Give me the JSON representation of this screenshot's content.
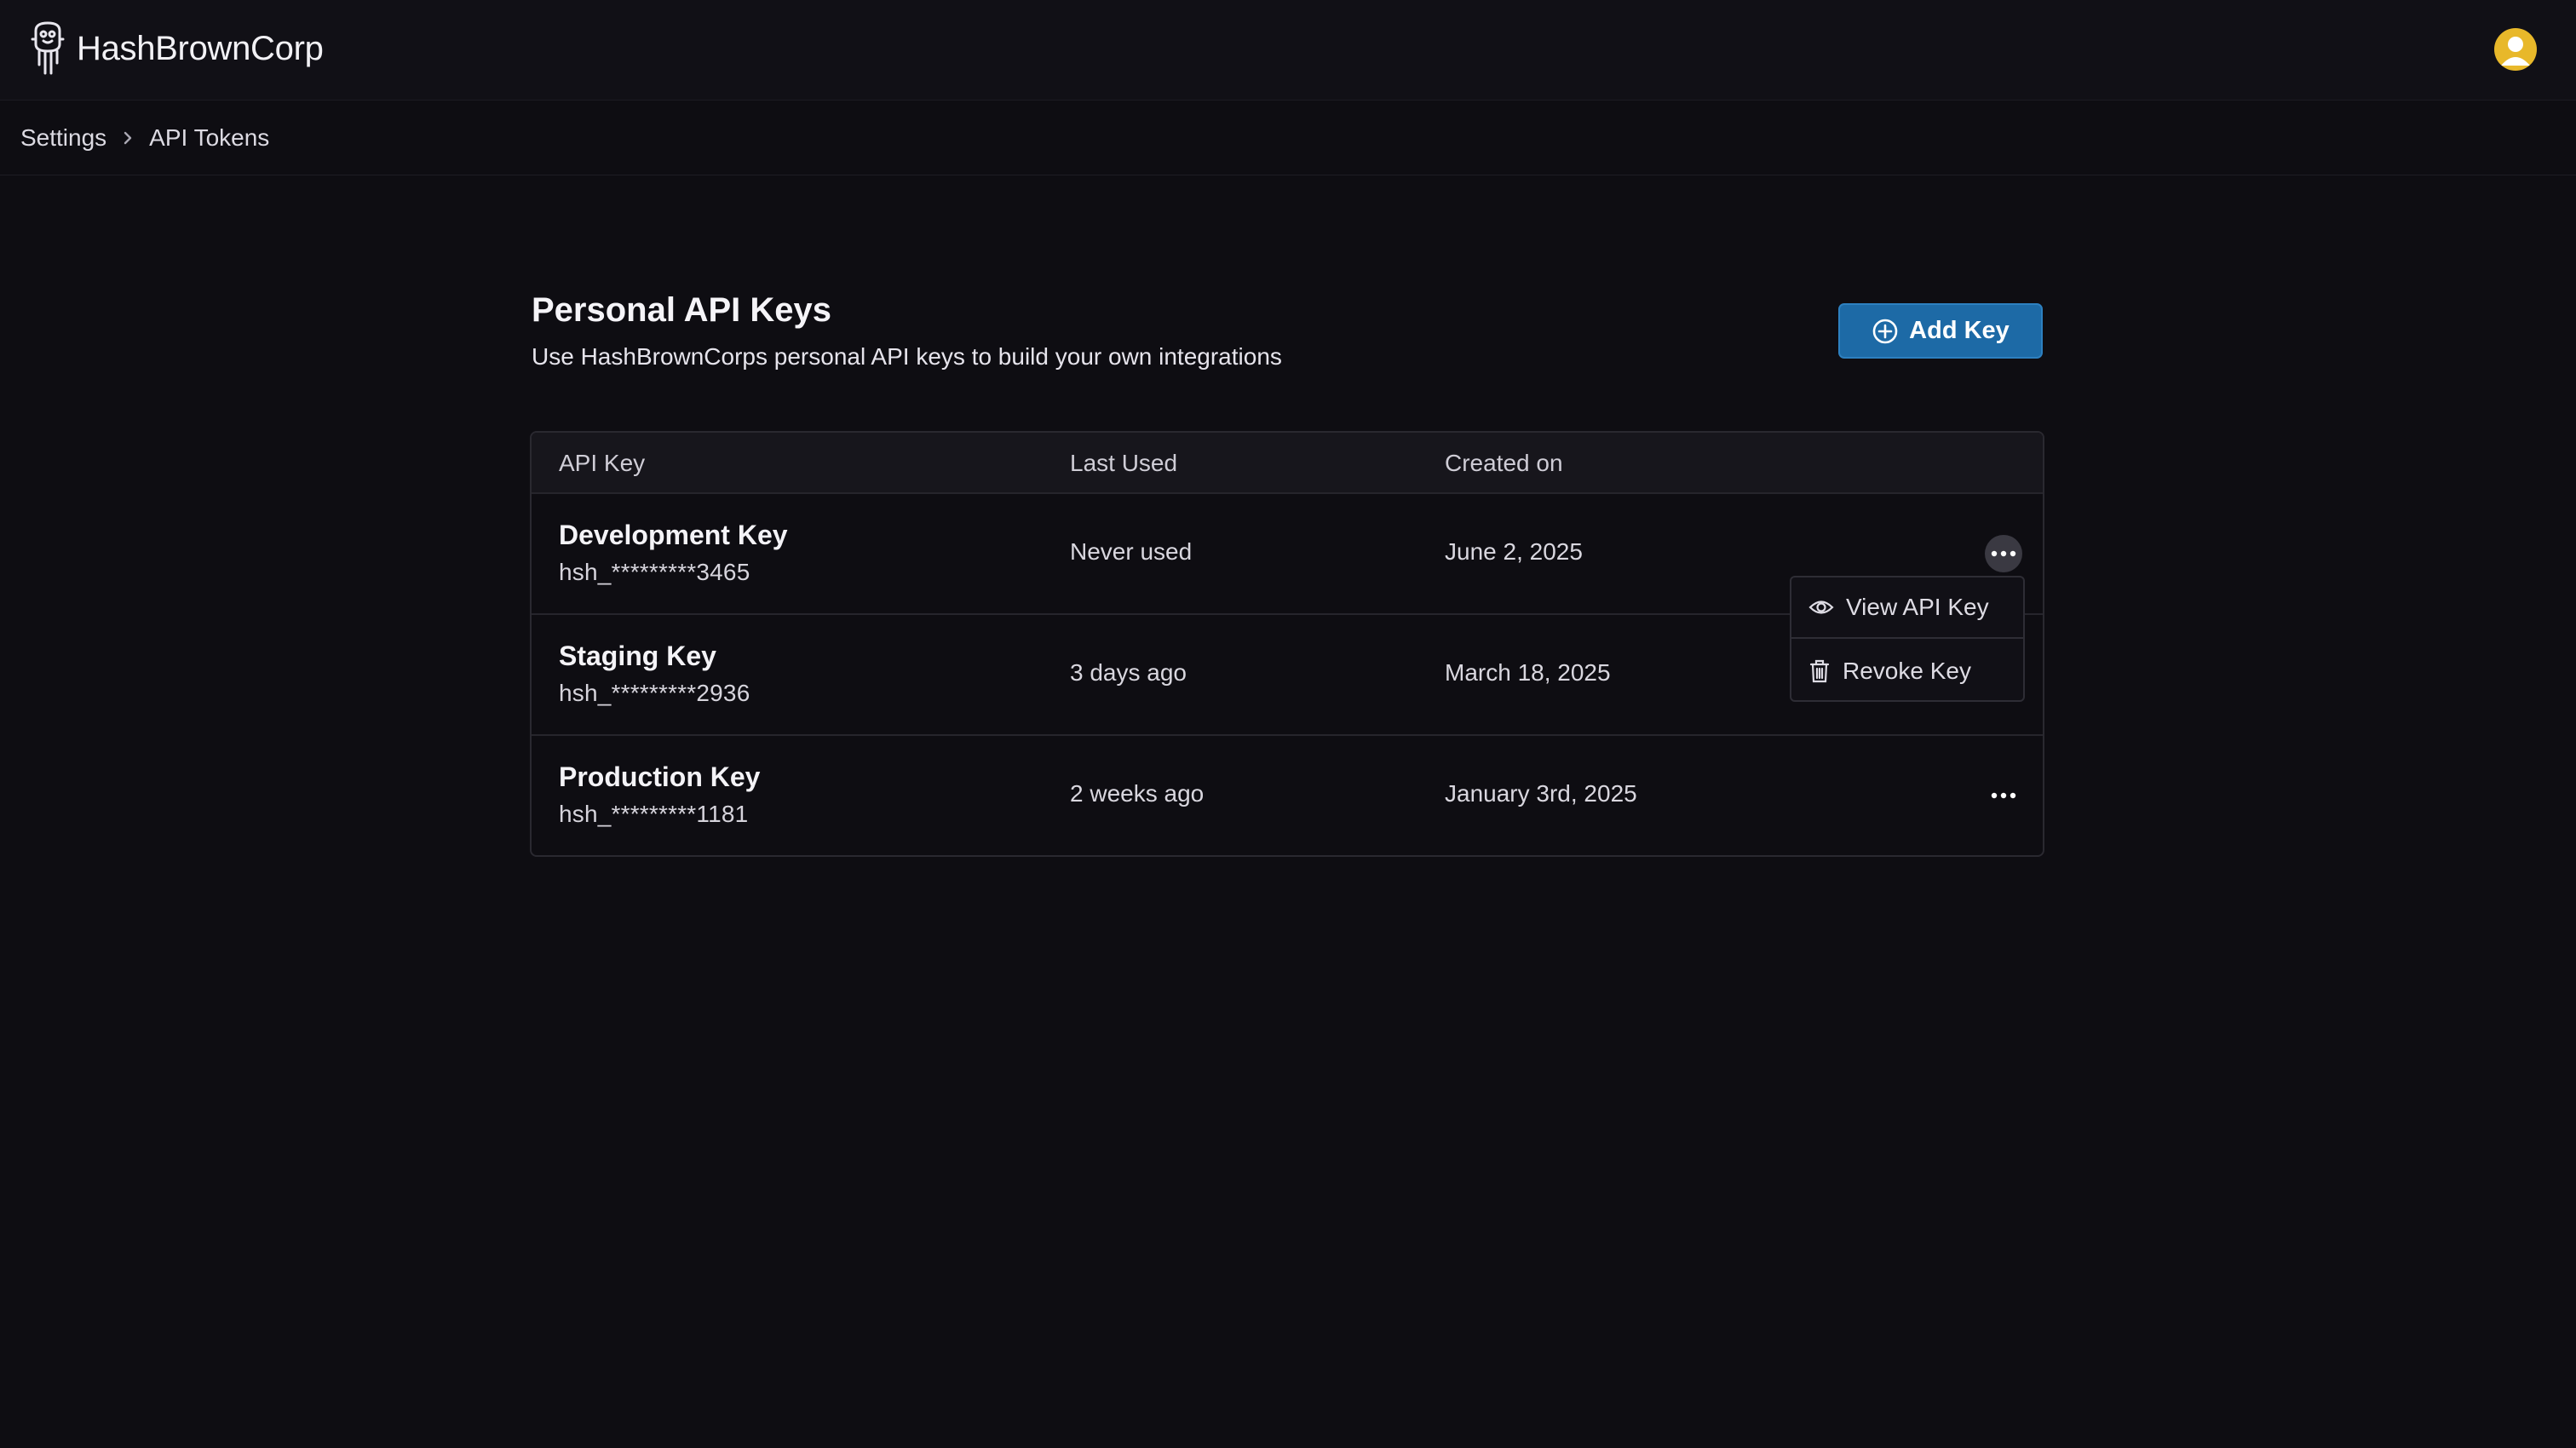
{
  "brand": {
    "name": "HashBrownCorp"
  },
  "breadcrumb": {
    "items": [
      "Settings",
      "API Tokens"
    ]
  },
  "section": {
    "title": "Personal API Keys",
    "subtitle": "Use HashBrownCorps personal API keys to build your own integrations",
    "add_button_label": "Add Key"
  },
  "table": {
    "headers": [
      "API Key",
      "Last Used",
      "Created on"
    ],
    "rows": [
      {
        "name": "Development Key",
        "masked": "hsh_*********3465",
        "last_used": "Never used",
        "created": "June 2, 2025"
      },
      {
        "name": "Staging Key",
        "masked": "hsh_*********2936",
        "last_used": "3 days ago",
        "created": "March 18, 2025"
      },
      {
        "name": "Production Key",
        "masked": "hsh_*********1181",
        "last_used": "2 weeks ago",
        "created": "January 3rd, 2025"
      }
    ]
  },
  "row_menu": {
    "open_for_row": 0,
    "items": [
      "View API Key",
      "Revoke Key"
    ]
  },
  "icons": [
    "logo-icon",
    "avatar-icon",
    "chevron-right-icon",
    "plus-circle-icon",
    "more-icon",
    "eye-icon",
    "trash-icon"
  ],
  "colors": {
    "background": "#0e0d12",
    "accent": "#1d6aa6",
    "avatar": "#e8b82a"
  }
}
